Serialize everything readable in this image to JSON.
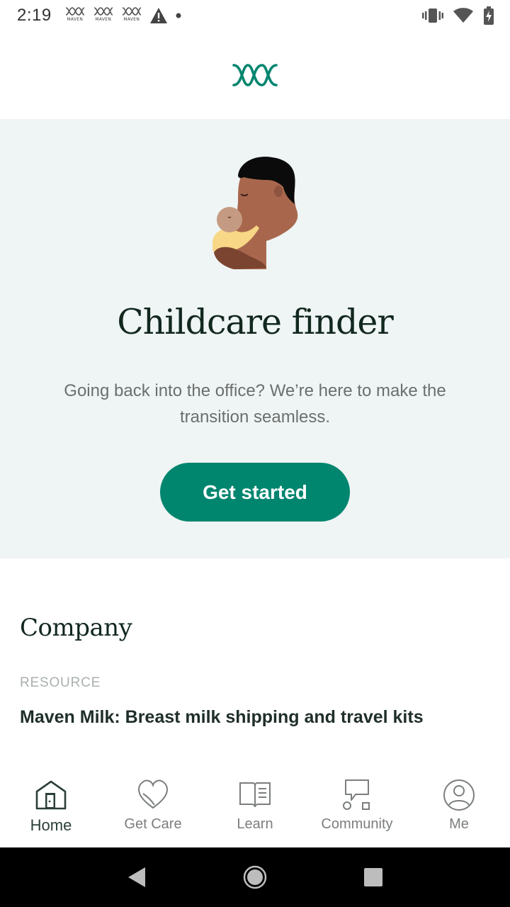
{
  "status_bar": {
    "time": "2:19",
    "notification_label": "MAVEN",
    "notification_count": 3
  },
  "hero": {
    "title": "Childcare finder",
    "description": "Going back into the office? We’re here to make the transition seamless.",
    "cta_label": "Get started"
  },
  "company": {
    "title": "Company",
    "resource_tag": "RESOURCE",
    "resource_title": "Maven Milk: Breast milk shipping and travel kits"
  },
  "nav": {
    "items": [
      {
        "label": "Home",
        "icon": "home-icon",
        "active": true
      },
      {
        "label": "Get Care",
        "icon": "heart-icon"
      },
      {
        "label": "Learn",
        "icon": "book-icon"
      },
      {
        "label": "Community",
        "icon": "chat-icon"
      },
      {
        "label": "Me",
        "icon": "profile-icon"
      }
    ]
  },
  "colors": {
    "brand": "#00856f",
    "hero_bg": "#eff5f4",
    "title": "#12281f"
  }
}
